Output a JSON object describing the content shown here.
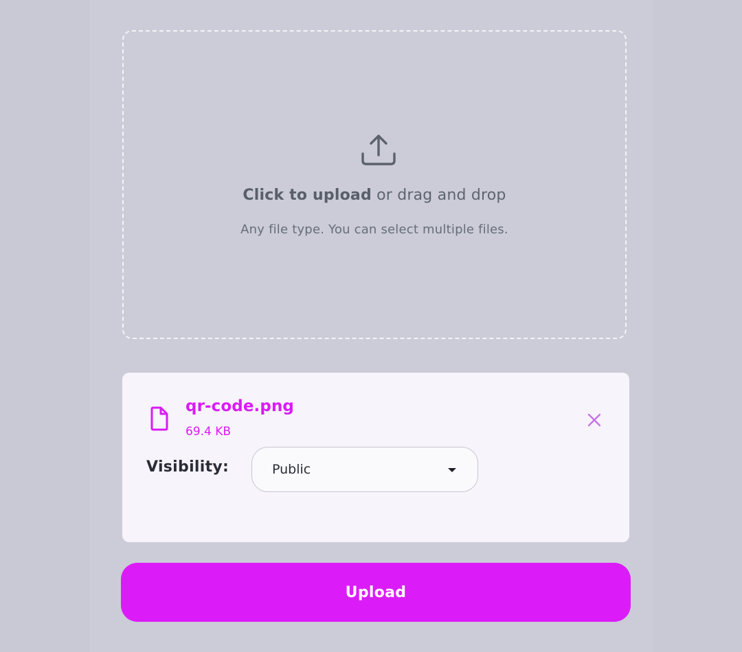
{
  "dropzone": {
    "title_strong": "Click to upload",
    "title_rest": " or drag and drop",
    "subtitle": "Any file type. You can select multiple files.",
    "icon": "upload-icon"
  },
  "file": {
    "name": "qr-code.png",
    "size": "69.4 KB",
    "icon": "file-icon",
    "remove_icon": "close-icon"
  },
  "visibility": {
    "label": "Visibility:",
    "selected": "Public",
    "caret_icon": "caret-down-icon"
  },
  "upload_button": {
    "label": "Upload"
  },
  "colors": {
    "accent": "#db1cf8",
    "background": "#cbccd7",
    "card": "#f8f4fc",
    "text_muted": "#5d6470"
  }
}
